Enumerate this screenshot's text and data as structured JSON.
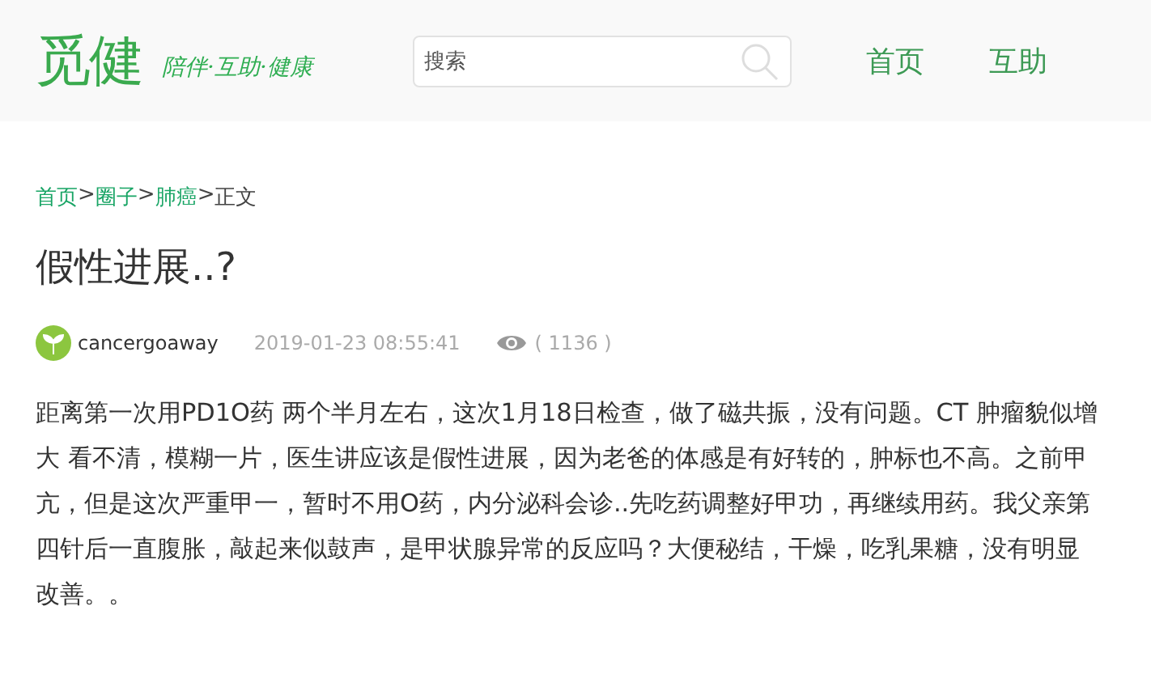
{
  "header": {
    "logo": "觅健",
    "slogan": "陪伴·互助·健康",
    "search": {
      "placeholder": "搜索"
    },
    "nav": [
      {
        "label": "首页"
      },
      {
        "label": "互助"
      }
    ]
  },
  "breadcrumb": {
    "links": [
      "首页",
      "圈子",
      "肺癌"
    ],
    "separator": ">",
    "current": "正文"
  },
  "post": {
    "title": "假性进展..?",
    "author": "cancergoaway",
    "time": "2019-01-23 08:55:41",
    "views": "( 1136 )",
    "body": "距离第一次用PD1O药 两个半月左右，这次1月18日检查，做了磁共振，没有问题。CT 肿瘤貌似增大 看不清，模糊一片，医生讲应该是假性进展，因为老爸的体感是有好转的，肿标也不高。之前甲亢，但是这次严重甲一，暂时不用O药，内分泌科会诊..先吃药调整好甲功，再继续用药。我父亲第四针后一直腹胀，敲起来似鼓声，是甲状腺异常的反应吗？大便秘结，干燥，吃乳果糖，没有明显改善。。"
  }
}
